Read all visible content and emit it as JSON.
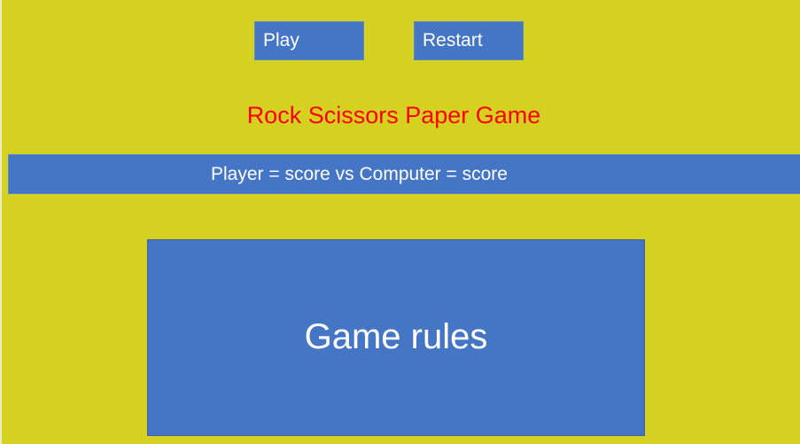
{
  "controls": {
    "play_label": "Play",
    "restart_label": "Restart"
  },
  "header": {
    "title": "Rock Scissors Paper Game"
  },
  "scoreboard": {
    "text": "Player = score vs Computer = score"
  },
  "rules": {
    "label": "Game rules"
  },
  "colors": {
    "background": "#d4d121",
    "panel": "#4576c5",
    "title": "#ff0000",
    "text": "#ffffff"
  }
}
